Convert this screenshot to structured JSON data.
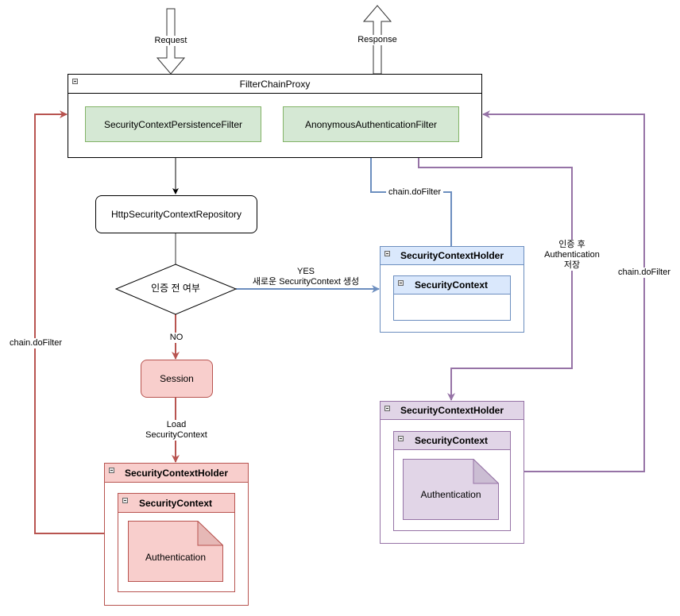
{
  "diagram": {
    "top_arrows": {
      "request": "Request",
      "response": "Response"
    },
    "filter_chain_proxy": {
      "title": "FilterChainProxy",
      "filters": [
        {
          "label": "SecurityContextPersistenceFilter"
        },
        {
          "label": "AnonymousAuthenticationFilter"
        }
      ]
    },
    "repository": {
      "label": "HttpSecurityContextRepository"
    },
    "decision": {
      "label": "인증 전 여부"
    },
    "yes_edge": {
      "line1": "YES",
      "line2": "새로운 SecurityContext 생성"
    },
    "no_edge": {
      "label": "NO"
    },
    "session": {
      "label": "Session"
    },
    "load_edge": {
      "line1": "Load",
      "line2": "SecurityContext"
    },
    "holder_new": {
      "title": "SecurityContextHolder",
      "context_title": "SecurityContext"
    },
    "holder_loaded": {
      "title": "SecurityContextHolder",
      "context_title": "SecurityContext",
      "authentication": "Authentication"
    },
    "holder_stored": {
      "title": "SecurityContextHolder",
      "context_title": "SecurityContext",
      "authentication": "Authentication"
    },
    "edges": {
      "blue_chain": "chain.doFilter",
      "red_chain": "chain.doFilter",
      "purple_chain": "chain.doFilter",
      "purple_store_line1": "인증 후",
      "purple_store_line2": "Authentication",
      "purple_store_line3": "저장"
    },
    "colors": {
      "green_fill": "#d5e8d4",
      "green_stroke": "#82b366",
      "red_fill": "#f8cecc",
      "red_stroke": "#b85450",
      "red_edge": "#b85450",
      "blue_fill": "#dae8fc",
      "blue_stroke": "#6c8ebf",
      "purple_fill": "#e1d5e7",
      "purple_stroke": "#9673a6"
    }
  }
}
